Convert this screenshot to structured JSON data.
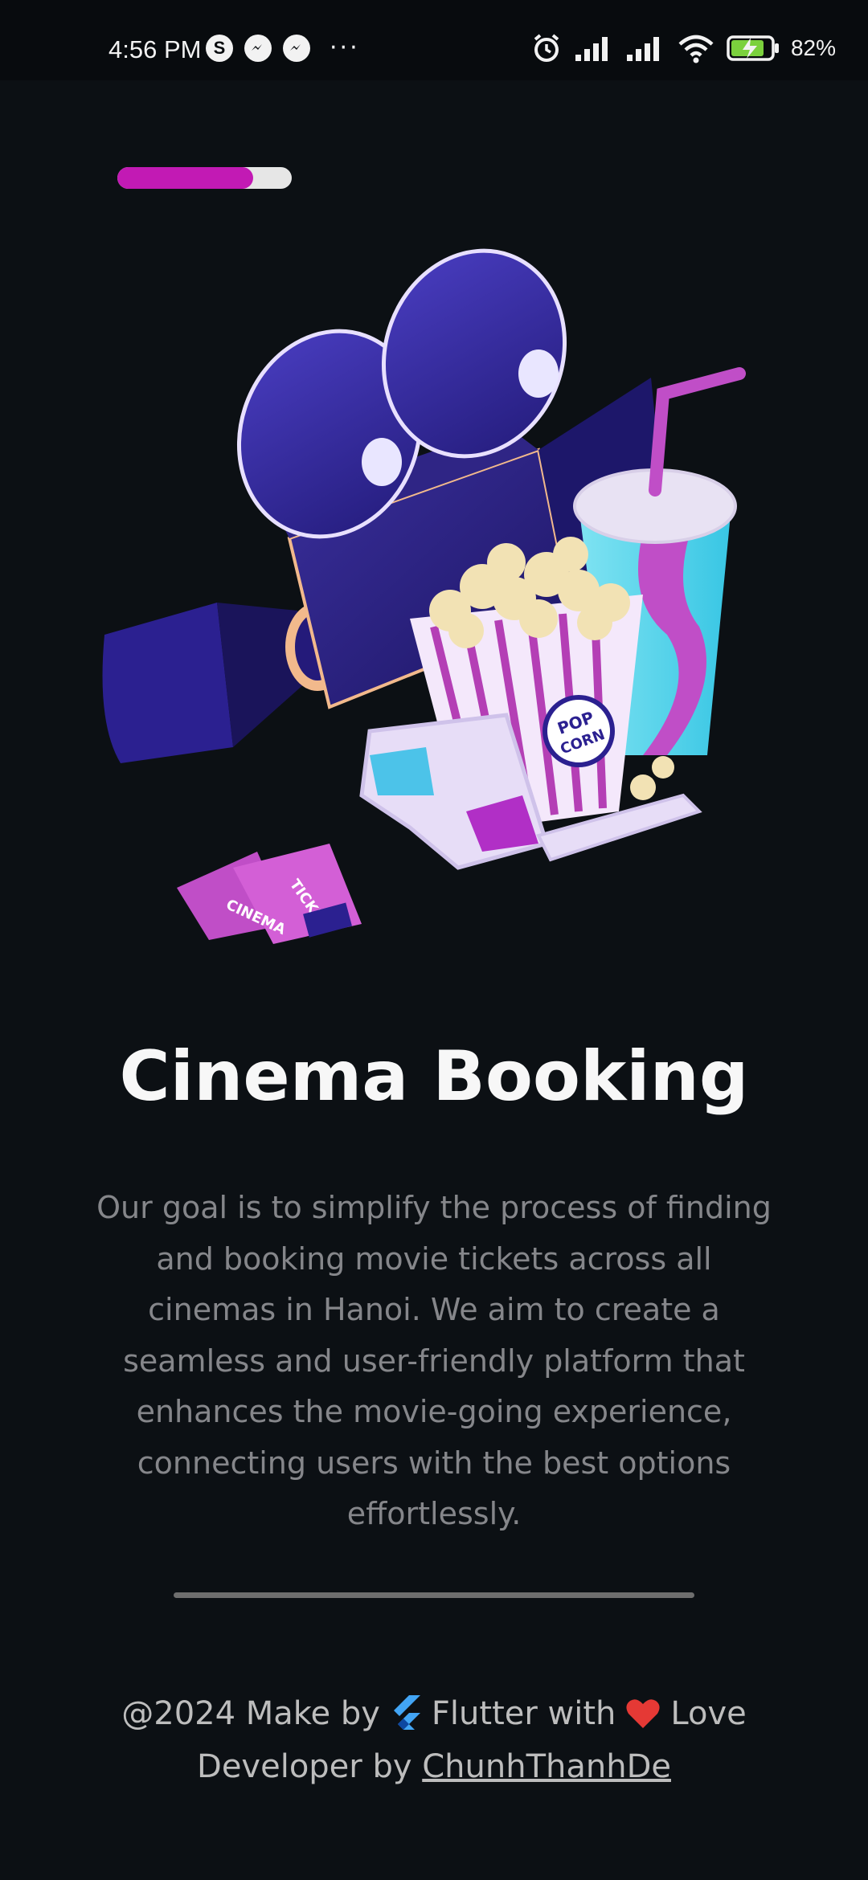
{
  "status_bar": {
    "time": "4:56 PM",
    "left_icons": [
      "skype-icon",
      "messenger-icon",
      "messenger-icon"
    ],
    "more": "···",
    "battery": "82%"
  },
  "onboarding": {
    "progress": 0.78,
    "progress_color": "#c21ab4",
    "illustration": "cinema-illustration",
    "title": "Cinema Booking",
    "description": "Our goal is to simplify the process of finding and booking movie tickets across all cinemas in Hanoi. We aim to create a seamless and user-friendly platform that enhances the movie-going experience, connecting users with the best options effortlessly."
  },
  "footer": {
    "prefix": "@2024 Make by",
    "framework": "Flutter with",
    "suffix": "Love",
    "developer_label": "Developer by",
    "developer_name": "ChunhThanhDe"
  },
  "colors": {
    "background": "#0c1014",
    "accent": "#c21ab4",
    "heart": "#e53935",
    "flutter": "#42a5f5"
  }
}
